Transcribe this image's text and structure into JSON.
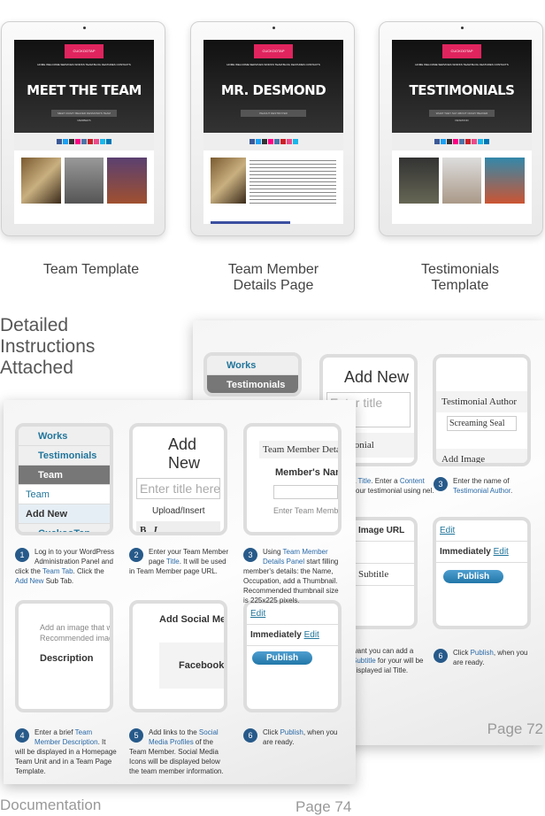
{
  "tablets": [
    {
      "logo": "CUCKOOTAP",
      "nav": "HOME WELCOME SERVICES WORKS TEAM BLOG FEATURES CONTACTS",
      "title": "MEET THE TEAM",
      "subtitle": "MEET CRAZY BEAVER DESMOND'S TEAM MEMBERS",
      "caption": "Team Template"
    },
    {
      "logo": "CUCKOOTAP",
      "nav": "HOME WELCOME SERVICES WORKS TEAM BLOG FEATURES CONTACTS",
      "title": "MR. DESMOND",
      "subtitle": "PEANUT DESTROYER",
      "caption": "Team Member Details Page"
    },
    {
      "logo": "CUCKOOTAP",
      "nav": "HOME WELCOME SERVICES WORKS TEAM BLOG FEATURES CONTACTS",
      "title": "TESTIMONIALS",
      "subtitle": "WHAT THEY SAY ABOUT CRAZY BEAVER DESMOND",
      "caption": "Testimonials Template"
    }
  ],
  "heading": "Detailed Instructions Attached",
  "back_page": {
    "menu": [
      "Works",
      "Testimonials"
    ],
    "add_new": "Add New",
    "title_placeholder": "Enter title here",
    "testimonial_label": "Testimonial",
    "author_label": "Testimonial Author",
    "author_placeholder": "Screaming Seal",
    "add_image": "Add Image",
    "image_url": "Image URL",
    "subtitle": "Subtitle",
    "edit": "Edit",
    "immediately": "Immediately",
    "publish": "Publish",
    "step2": {
      "pre": "a ",
      "title": "Title",
      "mid": ". Enter a ",
      "content": "Content",
      "post": " your testimonial using nel."
    },
    "step3": {
      "num": "3",
      "pre": "Enter the name of ",
      "link": "Testimonial Author",
      "post": "."
    },
    "step5": {
      "pre": "want you can add a ",
      "link": "Subtitle",
      "post": " for your will be displayed ial Title."
    },
    "step6": {
      "num": "6",
      "pre": "Click ",
      "link": "Publish",
      "post": ", when you are ready."
    },
    "page_label": "Page 72"
  },
  "front_page": {
    "menu": {
      "works": "Works",
      "testimonials": "Testimonials",
      "team": "Team",
      "sub_team": "Team",
      "add_new": "Add New",
      "cuckootap": "CuckooTap"
    },
    "add_new": "Add New",
    "title_placeholder": "Enter title here",
    "upload_insert": "Upload/Insert",
    "team_member_details": "Team Member Details",
    "members_name": "Member's Name",
    "enter_team_member": "Enter Team Member",
    "image_hint": "Add an image that will",
    "recommended": "Recommended image",
    "description": "Description",
    "add_social": "Add Social Media",
    "facebook": "Facebook",
    "edit": "Edit",
    "immediately": "Immediately",
    "publish": "Publish",
    "steps": [
      {
        "num": "1",
        "pre": "Log in to your WordPress Administration Panel and click the ",
        "link": "Team Tab",
        "mid": ". Click the ",
        "link2": "Add New",
        "post": " Sub Tab."
      },
      {
        "num": "2",
        "pre": "Enter your Team Member page ",
        "link": "Title",
        "mid": ". It will be used in Team Member page URL.",
        "link2": "",
        "post": ""
      },
      {
        "num": "3",
        "pre": "Using ",
        "link": "Team Member Details Panel",
        "mid": " start filling member's details: the Name, Occupation, add a Thumbnail. Recommended thumbnail size is 225x225 pixels.",
        "link2": "",
        "post": ""
      },
      {
        "num": "4",
        "pre": "Enter a brief ",
        "link": "Team Member Description",
        "mid": ". It will be displayed in a Homepage Team Unit and in a Team Page Template.",
        "link2": "",
        "post": ""
      },
      {
        "num": "5",
        "pre": "Add links to the ",
        "link": "Social Media Profiles",
        "mid": " of the Team Member. Social Media Icons will be displayed below the team member information.",
        "link2": "",
        "post": ""
      },
      {
        "num": "6",
        "pre": "Click ",
        "link": "Publish",
        "mid": ", when you are ready.",
        "link2": "",
        "post": ""
      }
    ],
    "doc_label": "Documentation",
    "page_label": "Page 74"
  },
  "colors": {
    "accent": "#e0245e",
    "step_badge": "#275a8a",
    "link": "#2a6aa8"
  }
}
